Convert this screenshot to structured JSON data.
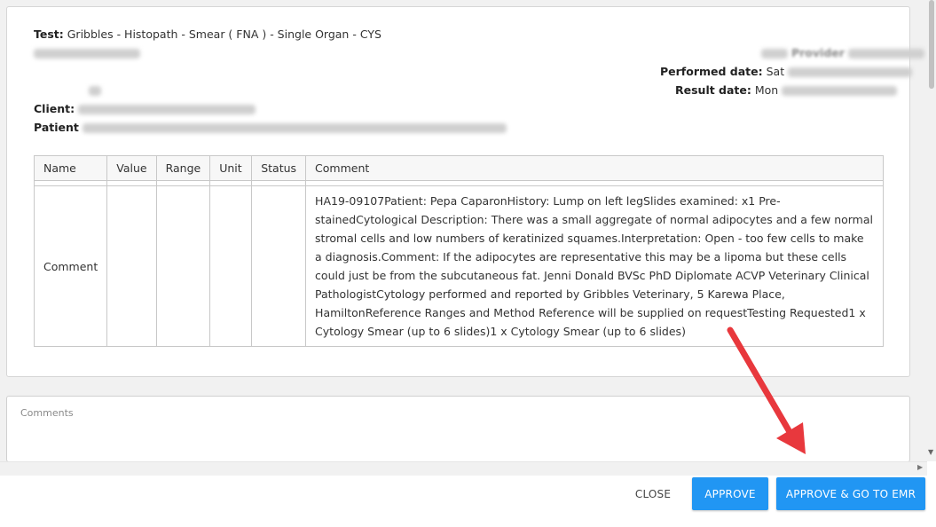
{
  "header": {
    "test_label": "Test:",
    "test_value": "Gribbles - Histopath - Smear ( FNA ) - Single Organ - CYS",
    "provider_label": "Provider",
    "performed_label": "Performed date:",
    "performed_value": "Sat",
    "result_label": "Result date:",
    "result_value": "Mon",
    "client_label": "Client:",
    "patient_label": "Patient"
  },
  "table": {
    "columns": [
      "Name",
      "Value",
      "Range",
      "Unit",
      "Status",
      "Comment"
    ],
    "rows": [
      {
        "name": "Comment",
        "value": "",
        "range": "",
        "unit": "",
        "status": "",
        "comment": "HA19-09107Patient: Pepa CaparonHistory: Lump on left legSlides examined: x1 Pre-stainedCytological Description: There was a small aggregate of normal adipocytes and a few normal stromal cells and low numbers of keratinized squames.Interpretation: Open - too few cells to make a diagnosis.Comment: If the adipocytes are representative this may be a lipoma but these cells could just be from the subcutaneous fat. Jenni Donald BVSc PhD Diplomate ACVP Veterinary Clinical PathologistCytology performed and reported by Gribbles Veterinary, 5 Karewa Place, HamiltonReference Ranges and Method Reference will be supplied on requestTesting Requested1 x Cytology Smear (up to 6 slides)1 x Cytology Smear (up to 6 slides)"
      }
    ]
  },
  "comments": {
    "placeholder": "Comments"
  },
  "footer": {
    "close_label": "CLOSE",
    "approve_label": "APPROVE",
    "approve_emr_label": "APPROVE & GO TO EMR"
  },
  "annotation": {
    "arrow_color": "#e8383d"
  },
  "theme": {
    "primary": "#2196f3"
  }
}
